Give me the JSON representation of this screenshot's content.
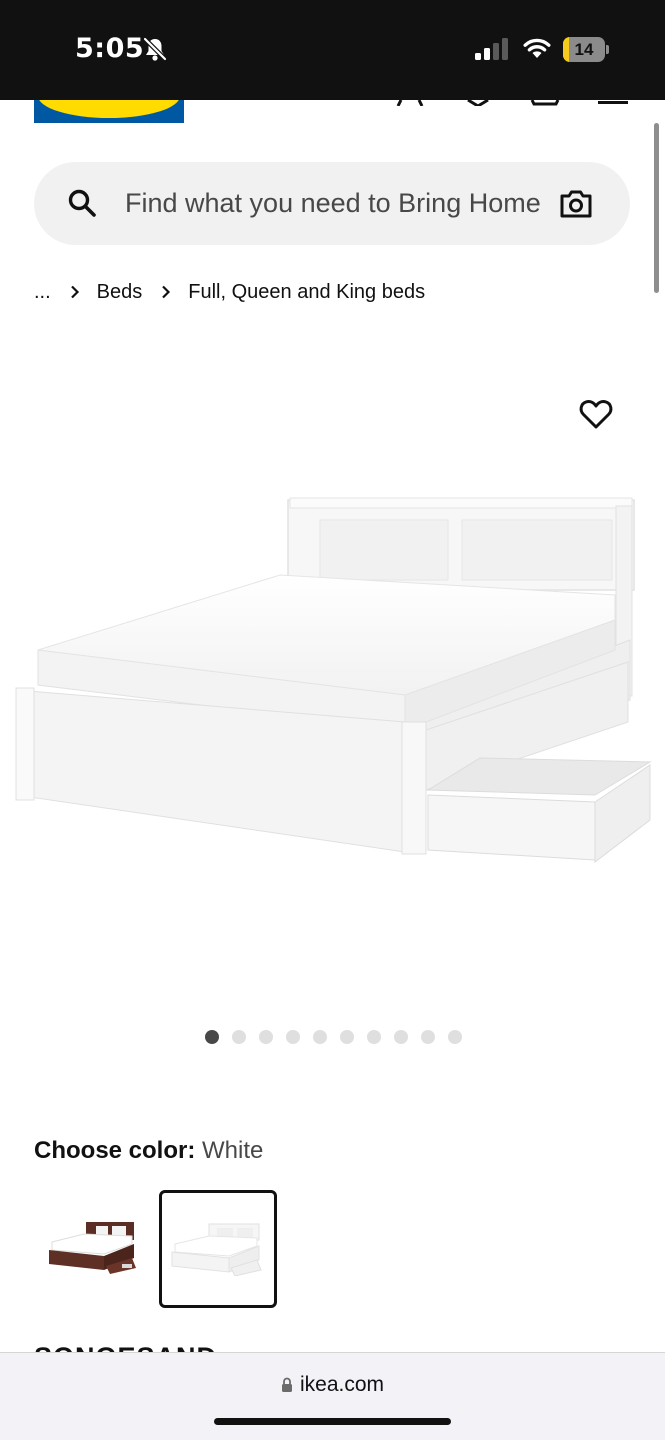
{
  "status_bar": {
    "time": "5:05",
    "battery_level": "14",
    "battery_fraction": 0.14,
    "icons": [
      "bell-slash-icon",
      "cellular-signal-icon",
      "wifi-icon",
      "battery-charging-icon"
    ]
  },
  "header": {
    "logo": "IKEA",
    "icons": [
      "profile-icon",
      "heart-icon",
      "cart-icon",
      "menu-icon"
    ]
  },
  "search": {
    "placeholder": "Find what you need to Bring Home",
    "icons": [
      "search-icon",
      "camera-icon"
    ]
  },
  "breadcrumb": {
    "items": [
      "...",
      "Beds",
      "Full, Queen and King beds"
    ]
  },
  "gallery": {
    "image": "white-storage-bed-photo",
    "favorite_icon": "heart-outline-icon",
    "dot_count": 10,
    "active_index": 0
  },
  "color_chooser": {
    "label": "Choose color:",
    "selected": "White",
    "options": [
      {
        "name": "brown-storage-bed-swatch",
        "selected": false
      },
      {
        "name": "white-storage-bed-swatch",
        "selected": true
      }
    ]
  },
  "product": {
    "name": "SONGESAND"
  },
  "browser": {
    "url": "ikea.com"
  },
  "colors": {
    "ikea_blue": "#0058a3",
    "ikea_yellow": "#ffdb00",
    "text": "#111111",
    "muted_text": "#484848",
    "search_bg": "#f1f1f1"
  }
}
